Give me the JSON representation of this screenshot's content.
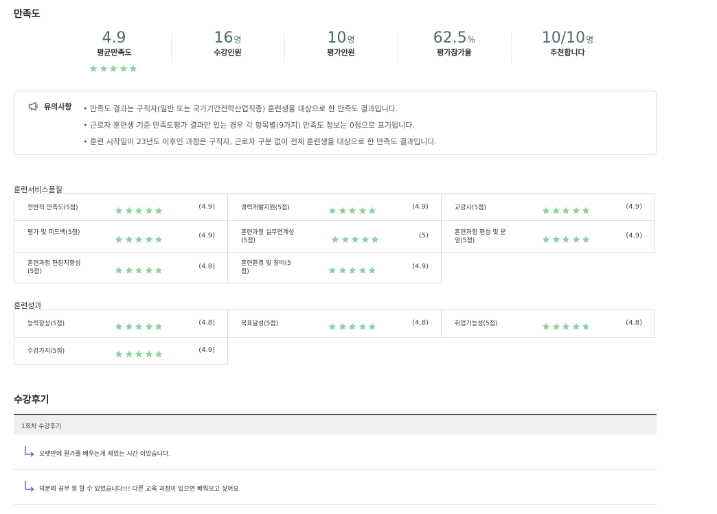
{
  "satisfaction": {
    "title": "만족도",
    "stats": [
      {
        "value": "4.9",
        "unit": "",
        "label": "평균만족도",
        "stars": 5
      },
      {
        "value": "16",
        "unit": "명",
        "label": "수강인원"
      },
      {
        "value": "10",
        "unit": "명",
        "label": "평가인원"
      },
      {
        "value": "62.5",
        "unit": "%",
        "label": "평가참가율"
      },
      {
        "value": "10/10",
        "unit": "명",
        "label": "추천합니다"
      }
    ]
  },
  "notice": {
    "title": "유의사항",
    "icon": "megaphone-icon",
    "items": [
      "• 만족도 결과는 구직자(일반 또는 국가기간전략산업직종) 훈련생을 대상으로 한 만족도 결과입니다.",
      "• 근로자 훈련생 기준 만족도평가 결과만 있는 경우 각 항목별(9가지) 만족도 정보는 0점으로 표기됩니다.",
      "• 훈련 시작일이 23년도 이후인 과정은 구직자, 근로자 구분 없이 전체 훈련생을 대상으로 한 만족도 결과입니다."
    ]
  },
  "service_quality": {
    "title": "훈련서비스품질",
    "items": [
      {
        "label": "전반적 만족도(5점)",
        "value": "(4.9)",
        "rating": 4.9
      },
      {
        "label": "경력개발지원(5점)",
        "value": "(4.9)",
        "rating": 4.9
      },
      {
        "label": "교강사(5점)",
        "value": "(4.9)",
        "rating": 4.9
      },
      {
        "label": "평가 및 피드백(5점)",
        "value": "(4.9)",
        "rating": 4.9
      },
      {
        "label": "훈련과정 실무연계성(5점)",
        "value": "(5)",
        "rating": 5
      },
      {
        "label": "훈련과정 편성 및 운영(5점)",
        "value": "(4.9)",
        "rating": 4.9
      },
      {
        "label": "훈련과정 현장지향성(5점)",
        "value": "(4.8)",
        "rating": 4.8
      },
      {
        "label": "훈련환경 및 장비(5점)",
        "value": "(4.9)",
        "rating": 4.9
      }
    ]
  },
  "training_outcome": {
    "title": "훈련성과",
    "items": [
      {
        "label": "능력향상(5점)",
        "value": "(4.8)",
        "rating": 4.8
      },
      {
        "label": "목표달성(5점)",
        "value": "(4.8)",
        "rating": 4.8
      },
      {
        "label": "취업가능성(5점)",
        "value": "(4.8)",
        "rating": 4.8
      },
      {
        "label": "수강가치(5점)",
        "value": "(4.9)",
        "rating": 4.9
      }
    ]
  },
  "reviews": {
    "title": "수강후기",
    "session": "1회차 수강후기",
    "items": [
      "오랫만에 뭔가를 배우는게 재밌는 시간 이었습니다.",
      "덕분에 공부 잘 할 수 있었습니다!!! 다른 교육 과정이 있으면 배워보고 싶어요"
    ]
  },
  "colors": {
    "star": "#8fd19e",
    "star_empty": "#dcdcdc",
    "stat_number": "#4a6b6e",
    "arrow": "#5a6ccf"
  }
}
